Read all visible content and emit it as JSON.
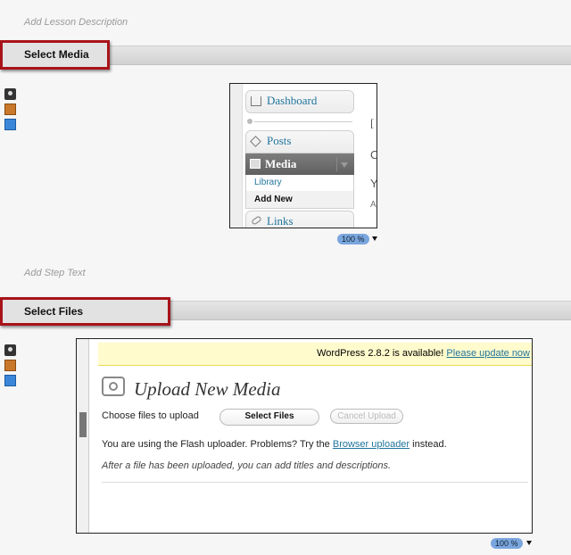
{
  "step1": {
    "lesson_description_placeholder": "Add Lesson Description",
    "title": "Select Media",
    "zoom": "100 %"
  },
  "shot1": {
    "dashboard": "Dashboard",
    "posts": "Posts",
    "media": "Media",
    "library": "Library",
    "add_new": "Add New",
    "links": "Links",
    "edge_chars": [
      "[",
      "C",
      "Y",
      "A"
    ]
  },
  "step2": {
    "step_text_placeholder": "Add Step Text",
    "title": "Select Files",
    "zoom": "100 %"
  },
  "shot2": {
    "notice_text": "WordPress 2.8.2 is available!",
    "notice_link": "Please update now",
    "heading": "Upload New Media",
    "choose_label": "Choose files to upload",
    "select_files": "Select Files",
    "cancel_upload": "Cancel Upload",
    "flash_text": "You are using the Flash uploader. Problems? Try the",
    "browser_uploader": "Browser uploader",
    "instead": "instead.",
    "after_text": "After a file has been uploaded, you can add titles and descriptions."
  },
  "icons": [
    "camera-icon",
    "clipboard-icon",
    "folder-add-icon"
  ]
}
